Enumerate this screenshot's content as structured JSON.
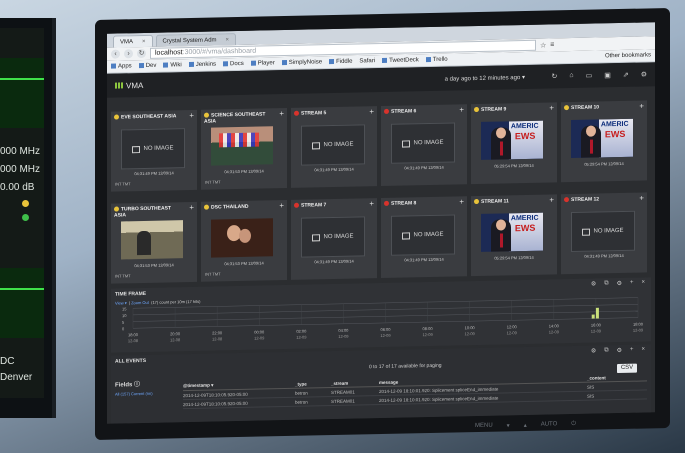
{
  "left_monitor": {
    "lines": [
      "000 MHz",
      "000 MHz",
      "0.00 dB",
      "DC",
      "Denver"
    ]
  },
  "browser": {
    "tabs": [
      {
        "label": "VMA"
      },
      {
        "label": "Crystal System Adm"
      }
    ],
    "url_host": "localhost",
    "url_rest": ":3000/#/vma/dashboard",
    "bookmarks": [
      "Apps",
      "Dev",
      "Wiki",
      "Jenkins",
      "Docs",
      "Player",
      "SimplyNoise",
      "Fiddle",
      "Safari",
      "TweetDeck",
      "Trello"
    ],
    "other_bookmarks": "Other bookmarks"
  },
  "app": {
    "title": "VMA",
    "time_range": "a day ago to 12 minutes ago ▾"
  },
  "streams": [
    {
      "title": "EVE SOUTHEAST ASIA",
      "status_color": "#e8c33a",
      "thumb": "none",
      "timestamp": "04:31:49 PM 12/09/14",
      "sub": "INT TMT"
    },
    {
      "title": "SCIENCE SOUTHEAST ASIA",
      "status_color": "#e8c33a",
      "thumb": "crowd",
      "timestamp": "04:31:53 PM 12/09/14",
      "sub": "INT TMT"
    },
    {
      "title": "STREAM 5",
      "status_color": "#d8332c",
      "thumb": "none",
      "timestamp": "04:31:49 PM 12/09/14",
      "sub": ""
    },
    {
      "title": "STREAM 6",
      "status_color": "#d8332c",
      "thumb": "none",
      "timestamp": "04:31:49 PM 12/09/14",
      "sub": ""
    },
    {
      "title": "STREAM 9",
      "status_color": "#e8c33a",
      "thumb": "news",
      "timestamp": "05:29:54 PM 12/09/14",
      "sub": ""
    },
    {
      "title": "STREAM 10",
      "status_color": "#e8c33a",
      "thumb": "news",
      "timestamp": "05:29:54 PM 12/09/14",
      "sub": ""
    },
    {
      "title": "TURBO SOUTHEAST ASIA",
      "status_color": "#e8c33a",
      "thumb": "kitchen",
      "timestamp": "04:31:53 PM 12/09/14",
      "sub": "INT TMT"
    },
    {
      "title": "DSC THAILAND",
      "status_color": "#e8c33a",
      "thumb": "couple",
      "timestamp": "04:31:53 PM 12/09/14",
      "sub": "INT TMT"
    },
    {
      "title": "STREAM 7",
      "status_color": "#d8332c",
      "thumb": "none",
      "timestamp": "04:31:49 PM 12/09/14",
      "sub": ""
    },
    {
      "title": "STREAM 8",
      "status_color": "#d8332c",
      "thumb": "none",
      "timestamp": "04:31:49 PM 12/09/14",
      "sub": ""
    },
    {
      "title": "STREAM 11",
      "status_color": "#e8c33a",
      "thumb": "news",
      "timestamp": "05:29:54 PM 12/09/14",
      "sub": ""
    },
    {
      "title": "STREAM 12",
      "status_color": "#d8332c",
      "thumb": "none",
      "timestamp": "04:31:49 PM 12/09/14",
      "sub": ""
    }
  ],
  "no_image_label": "NO IMAGE",
  "timeframe": {
    "title": "TIME FRAME",
    "view_label": "View ▾",
    "zoom_label": "Zoom Out",
    "count_text": "(17) count per 10m (17 hits)"
  },
  "chart_data": {
    "type": "bar",
    "x": [
      "18:00 12-08",
      "20:00 12-08",
      "22:00 12-08",
      "00:00 12-09",
      "02:00 12-09",
      "04:00 12-09",
      "06:00 12-09",
      "08:00 12-09",
      "10:00 12-09",
      "12:00 12-09",
      "14:00 12-09",
      "16:00 12-09",
      "18:00 12-09"
    ],
    "tick_times": [
      "18:00",
      "20:00",
      "22:00",
      "00:00",
      "02:00",
      "04:00",
      "06:00",
      "08:00",
      "10:00",
      "12:00",
      "14:00",
      "16:00",
      "18:00"
    ],
    "tick_dates": [
      "12-08",
      "12-08",
      "12-08",
      "12-09",
      "12-09",
      "12-09",
      "12-09",
      "12-09",
      "12-09",
      "12-09",
      "12-09",
      "12-09",
      "12-09"
    ],
    "y_ticks": [
      15,
      10,
      5,
      0
    ],
    "ylim": [
      0,
      15
    ],
    "bars": [
      {
        "time_hours": 21.8,
        "value": 3
      },
      {
        "time_hours": 22.0,
        "value": 8
      }
    ],
    "xlim_hours": [
      0,
      24
    ]
  },
  "events": {
    "title": "ALL EVENTS",
    "fields_label": "Fields",
    "fields_link": "All (157) Current (nn)",
    "count_text": "0 to 17 of 17 available for paging",
    "csv_label": "CSV",
    "columns": [
      "@timestamp ▾",
      "_type",
      "_stream",
      "message",
      "_content"
    ],
    "rows": [
      [
        "2014-12-09T18:10:05.920-05:00",
        "betron",
        "STREAM01",
        "2014-12-09 18:10:01.920: Splicement spliceEnd_immediate",
        "SIS"
      ],
      [
        "2014-12-09T18:10:05.920-05:00",
        "betron",
        "STREAM01",
        "2014-12-09 18:10:01.920: Splicement spliceEnd_immediate",
        "SIS"
      ]
    ]
  }
}
